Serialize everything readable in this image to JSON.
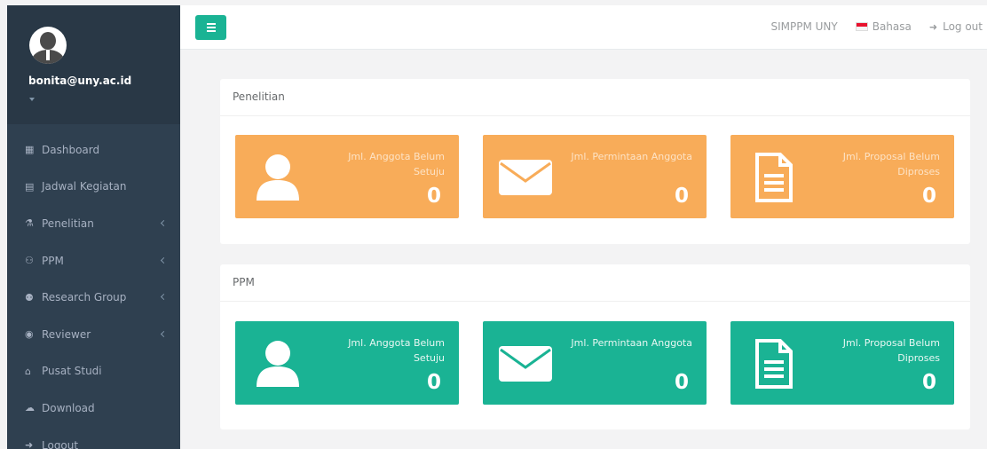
{
  "user": {
    "email": "bonita@uny.ac.id"
  },
  "sidebar": {
    "items": [
      {
        "label": "Dashboard",
        "icon": "grid-icon",
        "glyph": "▦",
        "has_arrow": false
      },
      {
        "label": "Jadwal Kegiatan",
        "icon": "calendar-icon",
        "glyph": "▤",
        "has_arrow": false
      },
      {
        "label": "Penelitian",
        "icon": "flask-icon",
        "glyph": "⚗",
        "has_arrow": true
      },
      {
        "label": "PPM",
        "icon": "binoculars-icon",
        "glyph": "⚇",
        "has_arrow": true
      },
      {
        "label": "Research Group",
        "icon": "users-icon",
        "glyph": "⚉",
        "has_arrow": true
      },
      {
        "label": "Reviewer",
        "icon": "eye-icon",
        "glyph": "◉",
        "has_arrow": true
      },
      {
        "label": "Pusat Studi",
        "icon": "bank-icon",
        "glyph": "⌂",
        "has_arrow": false
      },
      {
        "label": "Download",
        "icon": "cloud-download-icon",
        "glyph": "☁",
        "has_arrow": false
      },
      {
        "label": "Logout",
        "icon": "sign-out-icon",
        "glyph": "➜",
        "has_arrow": false
      }
    ]
  },
  "topbar": {
    "app_name": "SIMPPM UNY",
    "language": "Bahasa",
    "logout": "Log out"
  },
  "panels": [
    {
      "title": "Penelitian",
      "color": "#f8ac59",
      "boxes": [
        {
          "label": "Jml. Anggota Belum Setuju",
          "value": "0",
          "icon": "user-icon"
        },
        {
          "label": "Jml. Permintaan Anggota",
          "value": "0",
          "icon": "envelope-icon"
        },
        {
          "label": "Jml. Proposal Belum Diproses",
          "value": "0",
          "icon": "document-icon"
        }
      ]
    },
    {
      "title": "PPM",
      "color": "#1ab394",
      "boxes": [
        {
          "label": "Jml. Anggota Belum Setuju",
          "value": "0",
          "icon": "user-icon"
        },
        {
          "label": "Jml. Permintaan Anggota",
          "value": "0",
          "icon": "envelope-icon"
        },
        {
          "label": "Jml. Proposal Belum Diproses",
          "value": "0",
          "icon": "document-icon"
        }
      ]
    }
  ]
}
